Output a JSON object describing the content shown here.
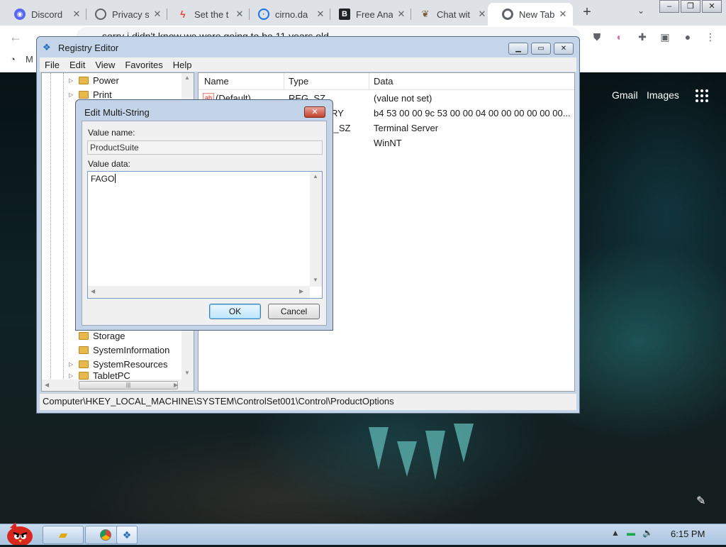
{
  "browser": {
    "tabs": [
      {
        "title": "Discord",
        "icon": "discord-icon",
        "color": "#5865f2"
      },
      {
        "title": "Privacy s",
        "icon": "privacy-icon",
        "color": "#5f6368"
      },
      {
        "title": "Set the t",
        "icon": "flame-icon",
        "color": "#e8453c"
      },
      {
        "title": "cirno.da",
        "icon": "cirno-icon",
        "color": "#1a73e8"
      },
      {
        "title": "Free Ana",
        "icon": "b-logo-icon",
        "color": "#202124"
      },
      {
        "title": "Chat wit",
        "icon": "chat-icon",
        "color": "#7a5c3a"
      },
      {
        "title": "New Tab",
        "icon": "chrome-icon",
        "color": "#5f6368"
      }
    ],
    "address_text": "sorry i didn't know we were going to be 11 years old",
    "bookmark_initial": "M"
  },
  "newtab": {
    "gmail": "Gmail",
    "images": "Images"
  },
  "regedit": {
    "title": "Registry Editor",
    "menu": [
      "File",
      "Edit",
      "View",
      "Favorites",
      "Help"
    ],
    "tree_top": [
      {
        "label": "Power"
      },
      {
        "label": "Print"
      }
    ],
    "tree_bottom": [
      {
        "label": "Storage"
      },
      {
        "label": "SystemInformation"
      },
      {
        "label": "SystemResources"
      },
      {
        "label": "TabletPC"
      }
    ],
    "columns": {
      "name": "Name",
      "type": "Type",
      "data": "Data"
    },
    "rows": [
      {
        "name": "(Default)",
        "type": "REG_SZ",
        "data": "(value not set)"
      },
      {
        "name": "",
        "type": "RY",
        "data": "b4 53 00 00 9c 53 00 00 04 00 00 00 00 00 00..."
      },
      {
        "name": "",
        "type": "I_SZ",
        "data": "Terminal Server"
      },
      {
        "name": "",
        "type": "",
        "data": "WinNT"
      }
    ],
    "status": "Computer\\HKEY_LOCAL_MACHINE\\SYSTEM\\ControlSet001\\Control\\ProductOptions"
  },
  "dialog": {
    "title": "Edit Multi-String",
    "value_name_label": "Value name:",
    "value_name": "ProductSuite",
    "value_data_label": "Value data:",
    "value_data": "FAGO",
    "ok": "OK",
    "cancel": "Cancel"
  },
  "taskbar": {
    "time": "6:15 PM"
  }
}
